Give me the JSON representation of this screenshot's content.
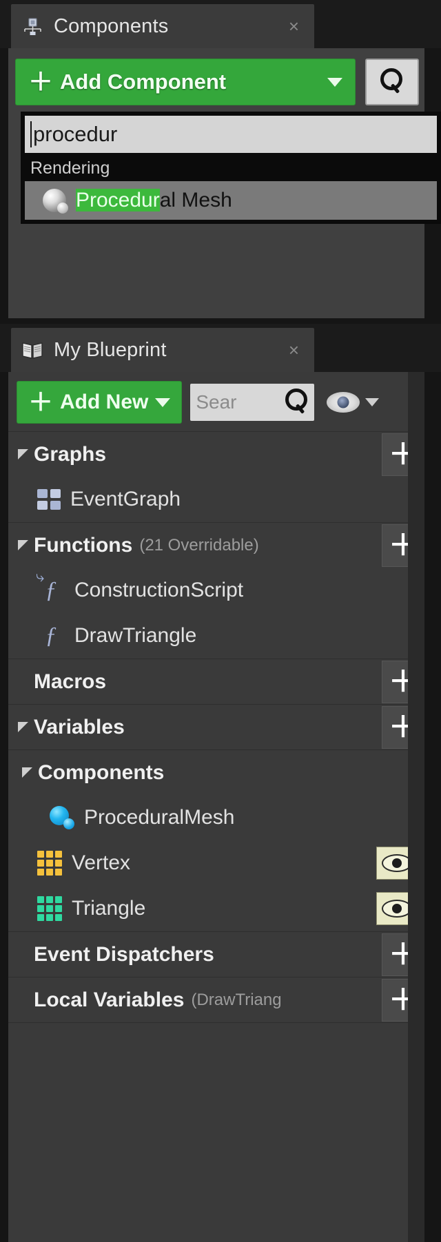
{
  "components_panel": {
    "tab": {
      "title": "Components",
      "icon": "components-icon",
      "close": "×"
    },
    "add_component": {
      "label": "Add Component",
      "plus": "＋",
      "icon": "chevron-down-icon"
    },
    "search_button_icon": "search-icon",
    "dropdown": {
      "search_value": "procedur",
      "section_label": "Rendering",
      "item": {
        "match": "Procedur",
        "rest": "al Mesh",
        "icon": "procedural-mesh-icon"
      }
    }
  },
  "blueprint_panel": {
    "tab": {
      "title": "My Blueprint",
      "icon": "blueprint-book-icon",
      "close": "×"
    },
    "toolbar": {
      "add_new_label": "Add New",
      "plus": "＋",
      "search_placeholder": "Sear",
      "search_icon": "search-icon",
      "eye_icon": "visibility-eye-icon",
      "eye_caret": "chevron-down-icon"
    },
    "sections": [
      {
        "label": "Graphs",
        "sub": "",
        "add": "＋",
        "items": [
          {
            "label": "EventGraph",
            "icon": "event-graph-icon"
          }
        ]
      },
      {
        "label": "Functions",
        "sub": "(21 Overridable)",
        "add": "＋",
        "items": [
          {
            "label": "ConstructionScript",
            "icon": "construction-script-icon"
          },
          {
            "label": "DrawTriangle",
            "icon": "function-icon"
          }
        ]
      },
      {
        "label": "Macros",
        "sub": "",
        "add": "＋",
        "items": []
      },
      {
        "label": "Variables",
        "sub": "",
        "add": "＋",
        "items": []
      }
    ],
    "components_group": {
      "label": "Components",
      "items": [
        {
          "label": "ProceduralMesh",
          "icon": "procedural-mesh-icon",
          "eye": false
        },
        {
          "label": "Vertex",
          "icon": "array-vector-grid-icon",
          "color": "#f5c13c",
          "eye": true
        },
        {
          "label": "Triangle",
          "icon": "array-int-grid-icon",
          "color": "#2fd9a0",
          "eye": true
        }
      ]
    },
    "bottom_sections": [
      {
        "label": "Event Dispatchers",
        "sub": "",
        "add": "＋"
      },
      {
        "label": "Local Variables",
        "sub": "(DrawTriang",
        "add": "＋"
      }
    ]
  },
  "colors": {
    "accent_green": "#35a73c",
    "highlight_green": "#3cb93c",
    "panel_bg": "#3a3a3a",
    "vertex_yellow": "#f5c13c",
    "triangle_teal": "#2fd9a0"
  }
}
